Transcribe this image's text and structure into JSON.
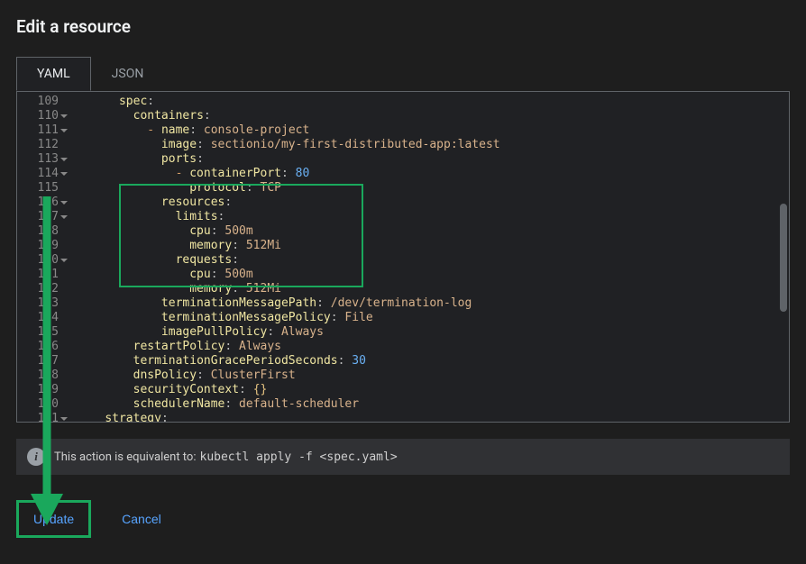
{
  "title": "Edit a resource",
  "tabs": {
    "yaml": "YAML",
    "json": "JSON",
    "active": "yaml"
  },
  "editor": {
    "lines": [
      {
        "num": 109,
        "fold": false,
        "indent": 6,
        "tokens": [
          [
            "k",
            "spec"
          ],
          [
            "c",
            ":"
          ]
        ]
      },
      {
        "num": 110,
        "fold": true,
        "indent": 8,
        "tokens": [
          [
            "k",
            "containers"
          ],
          [
            "c",
            ":"
          ]
        ]
      },
      {
        "num": 111,
        "fold": true,
        "indent": 10,
        "tokens": [
          [
            "d",
            "- "
          ],
          [
            "k",
            "name"
          ],
          [
            "c",
            ": "
          ],
          [
            "s",
            "console-project"
          ]
        ]
      },
      {
        "num": 112,
        "fold": false,
        "indent": 12,
        "tokens": [
          [
            "k",
            "image"
          ],
          [
            "c",
            ": "
          ],
          [
            "s",
            "sectionio/my-first-distributed-app:latest"
          ]
        ]
      },
      {
        "num": 113,
        "fold": true,
        "indent": 12,
        "tokens": [
          [
            "k",
            "ports"
          ],
          [
            "c",
            ":"
          ]
        ]
      },
      {
        "num": 114,
        "fold": true,
        "indent": 14,
        "tokens": [
          [
            "d",
            "- "
          ],
          [
            "k",
            "containerPort"
          ],
          [
            "c",
            ": "
          ],
          [
            "n",
            "80"
          ]
        ]
      },
      {
        "num": 115,
        "fold": false,
        "indent": 16,
        "tokens": [
          [
            "k",
            "protocol"
          ],
          [
            "c",
            ": "
          ],
          [
            "s",
            "TCP"
          ]
        ]
      },
      {
        "num": 116,
        "fold": true,
        "indent": 12,
        "tokens": [
          [
            "k",
            "resources"
          ],
          [
            "c",
            ":"
          ]
        ]
      },
      {
        "num": 117,
        "fold": true,
        "indent": 14,
        "tokens": [
          [
            "k",
            "limits"
          ],
          [
            "c",
            ":"
          ]
        ]
      },
      {
        "num": 118,
        "fold": false,
        "indent": 16,
        "tokens": [
          [
            "k",
            "cpu"
          ],
          [
            "c",
            ": "
          ],
          [
            "s",
            "500m"
          ]
        ]
      },
      {
        "num": 119,
        "fold": false,
        "indent": 16,
        "tokens": [
          [
            "k",
            "memory"
          ],
          [
            "c",
            ": "
          ],
          [
            "s",
            "512Mi"
          ]
        ]
      },
      {
        "num": 120,
        "fold": true,
        "indent": 14,
        "tokens": [
          [
            "k",
            "requests"
          ],
          [
            "c",
            ":"
          ]
        ]
      },
      {
        "num": 121,
        "fold": false,
        "indent": 16,
        "tokens": [
          [
            "k",
            "cpu"
          ],
          [
            "c",
            ": "
          ],
          [
            "s",
            "500m"
          ]
        ]
      },
      {
        "num": 122,
        "fold": false,
        "indent": 16,
        "tokens": [
          [
            "k",
            "memory"
          ],
          [
            "c",
            ": "
          ],
          [
            "s",
            "512Mi"
          ]
        ]
      },
      {
        "num": 123,
        "fold": false,
        "indent": 12,
        "tokens": [
          [
            "k",
            "terminationMessagePath"
          ],
          [
            "c",
            ": "
          ],
          [
            "s",
            "/dev/termination-log"
          ]
        ]
      },
      {
        "num": 124,
        "fold": false,
        "indent": 12,
        "tokens": [
          [
            "k",
            "terminationMessagePolicy"
          ],
          [
            "c",
            ": "
          ],
          [
            "s",
            "File"
          ]
        ]
      },
      {
        "num": 125,
        "fold": false,
        "indent": 12,
        "tokens": [
          [
            "k",
            "imagePullPolicy"
          ],
          [
            "c",
            ": "
          ],
          [
            "s",
            "Always"
          ]
        ]
      },
      {
        "num": 126,
        "fold": false,
        "indent": 8,
        "tokens": [
          [
            "k",
            "restartPolicy"
          ],
          [
            "c",
            ": "
          ],
          [
            "s",
            "Always"
          ]
        ]
      },
      {
        "num": 127,
        "fold": false,
        "indent": 8,
        "tokens": [
          [
            "k",
            "terminationGracePeriodSeconds"
          ],
          [
            "c",
            ": "
          ],
          [
            "n",
            "30"
          ]
        ]
      },
      {
        "num": 128,
        "fold": false,
        "indent": 8,
        "tokens": [
          [
            "k",
            "dnsPolicy"
          ],
          [
            "c",
            ": "
          ],
          [
            "s",
            "ClusterFirst"
          ]
        ]
      },
      {
        "num": 129,
        "fold": false,
        "indent": 8,
        "tokens": [
          [
            "k",
            "securityContext"
          ],
          [
            "c",
            ": "
          ],
          [
            "br",
            "{}"
          ]
        ]
      },
      {
        "num": 130,
        "fold": false,
        "indent": 8,
        "tokens": [
          [
            "k",
            "schedulerName"
          ],
          [
            "c",
            ": "
          ],
          [
            "s",
            "default-scheduler"
          ]
        ]
      },
      {
        "num": 131,
        "fold": true,
        "indent": 4,
        "tokens": [
          [
            "k",
            "strategy"
          ],
          [
            "c",
            ":"
          ]
        ]
      }
    ]
  },
  "info": {
    "text": "This action is equivalent to:",
    "cmd": "kubectl apply -f <spec.yaml>"
  },
  "actions": {
    "update": "Update",
    "cancel": "Cancel"
  }
}
